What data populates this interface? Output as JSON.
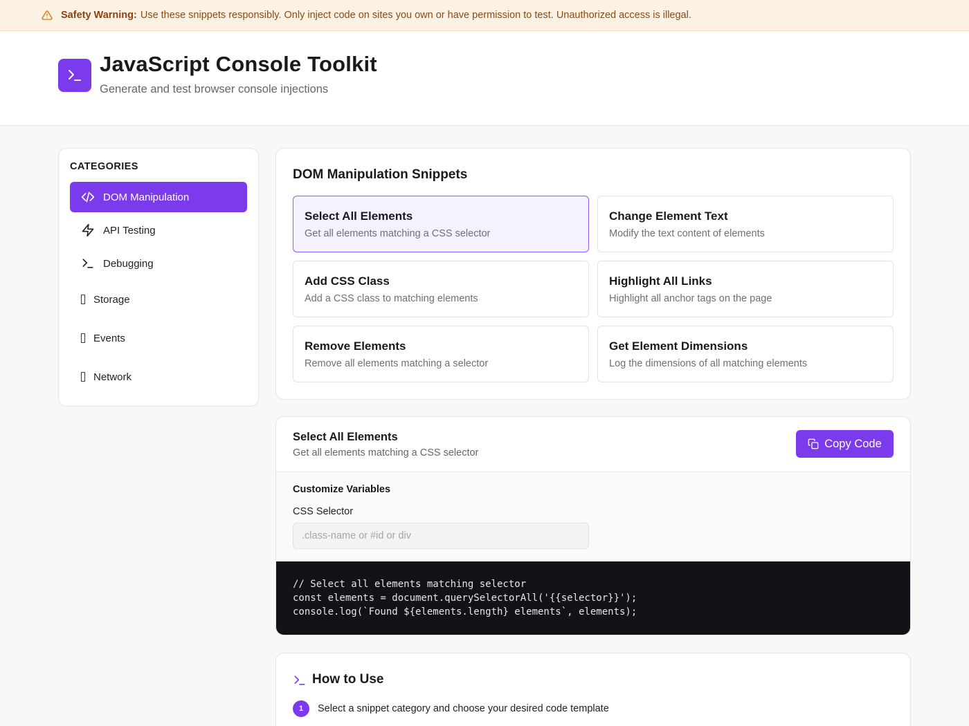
{
  "warning": {
    "label": "Safety Warning:",
    "text": "Use these snippets responsibly. Only inject code on sites you own or have permission to test. Unauthorized access is illegal."
  },
  "header": {
    "title": "JavaScript Console Toolkit",
    "subtitle": "Generate and test browser console injections"
  },
  "sidebar": {
    "heading": "CATEGORIES",
    "items": [
      {
        "label": "DOM Manipulation",
        "icon": "code-icon",
        "active": true
      },
      {
        "label": "API Testing",
        "icon": "lightning-icon",
        "active": false
      },
      {
        "label": "Debugging",
        "icon": "terminal-icon",
        "active": false
      },
      {
        "label": "Storage",
        "icon": "missing-glyph-icon",
        "active": false
      },
      {
        "label": "Events",
        "icon": "missing-glyph-icon",
        "active": false
      },
      {
        "label": "Network",
        "icon": "missing-glyph-icon",
        "active": false
      }
    ]
  },
  "snippets": {
    "title": "DOM Manipulation Snippets",
    "items": [
      {
        "title": "Select All Elements",
        "desc": "Get all elements matching a CSS selector",
        "selected": true
      },
      {
        "title": "Change Element Text",
        "desc": "Modify the text content of elements",
        "selected": false
      },
      {
        "title": "Add CSS Class",
        "desc": "Add a CSS class to matching elements",
        "selected": false
      },
      {
        "title": "Highlight All Links",
        "desc": "Highlight all anchor tags on the page",
        "selected": false
      },
      {
        "title": "Remove Elements",
        "desc": "Remove all elements matching a selector",
        "selected": false
      },
      {
        "title": "Get Element Dimensions",
        "desc": "Log the dimensions of all matching elements",
        "selected": false
      }
    ]
  },
  "detail": {
    "title": "Select All Elements",
    "desc": "Get all elements matching a CSS selector",
    "copy_label": "Copy Code",
    "vars_title": "Customize Variables",
    "var_label": "CSS Selector",
    "var_value": "",
    "var_placeholder": ".class-name or #id or div",
    "code": "// Select all elements matching selector\nconst elements = document.querySelectorAll('{{selector}}');\nconsole.log(`Found ${elements.length} elements`, elements);"
  },
  "howto": {
    "title": "How to Use",
    "steps": [
      {
        "num": "1",
        "text": "Select a snippet category and choose your desired code template"
      }
    ]
  },
  "colors": {
    "accent": "#7c3aed",
    "warning_bg": "#fdf1e4",
    "code_bg": "#111318"
  }
}
